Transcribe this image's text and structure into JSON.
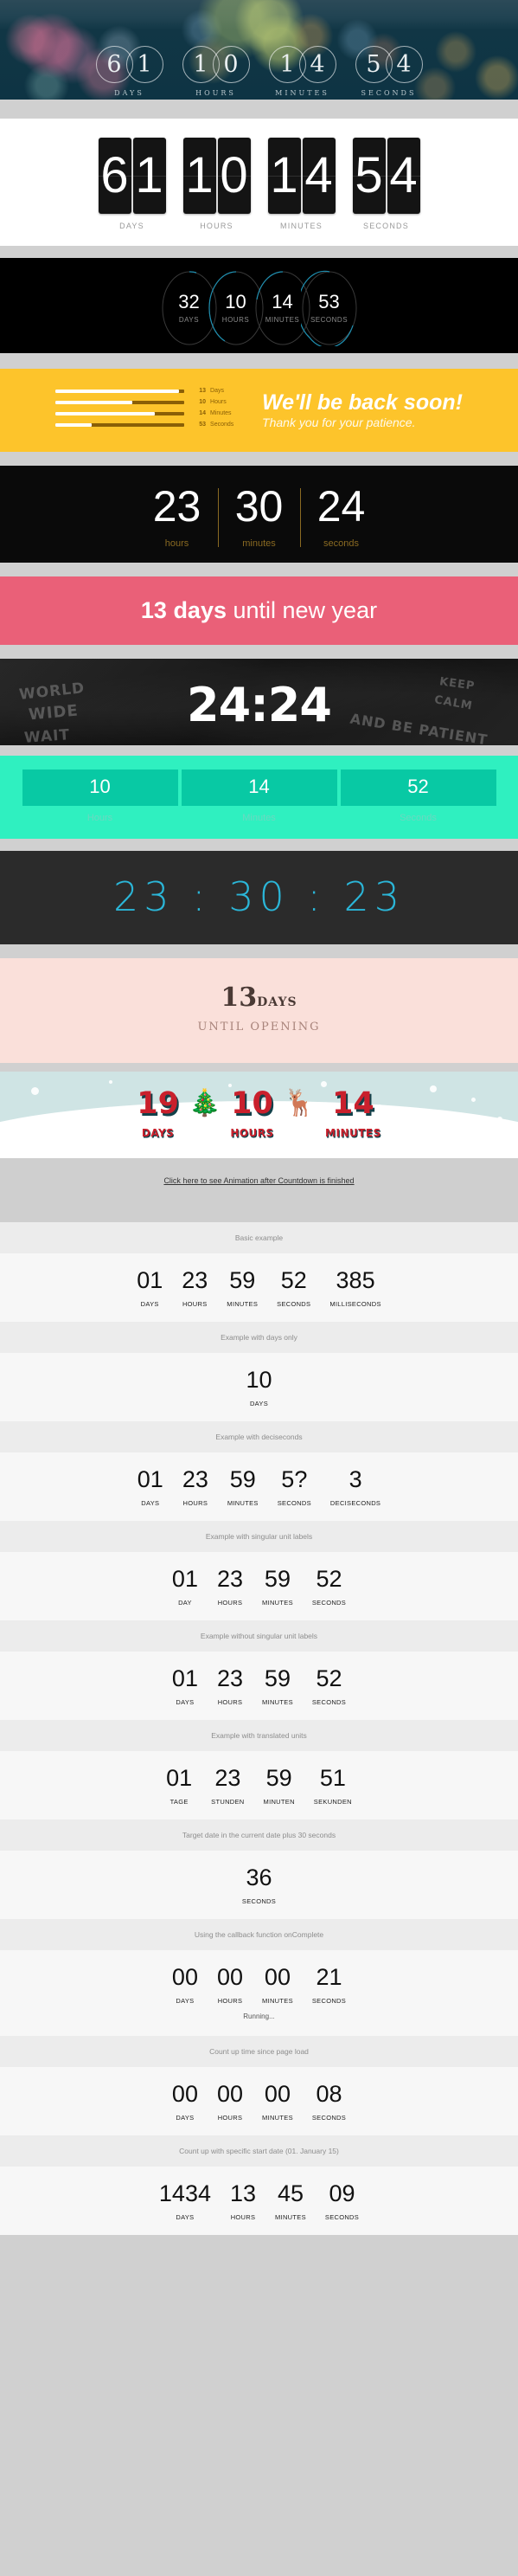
{
  "hero": {
    "digits": [
      "6",
      "1",
      "1",
      "0",
      "1",
      "4",
      "5",
      "4"
    ],
    "labels": [
      "DAYS",
      "HOURS",
      "MINUTES",
      "SECONDS"
    ]
  },
  "flip": {
    "units": [
      {
        "digits": [
          "6",
          "1"
        ],
        "label": "DAYS"
      },
      {
        "digits": [
          "1",
          "0"
        ],
        "label": "HOURS"
      },
      {
        "digits": [
          "1",
          "4"
        ],
        "label": "MINUTES"
      },
      {
        "digits": [
          "5",
          "4"
        ],
        "label": "SECONDS"
      }
    ]
  },
  "rings": {
    "accent": "#1f8fb0",
    "units": [
      {
        "value": "32",
        "label": "DAYS",
        "pct": 10
      },
      {
        "value": "10",
        "label": "HOURS",
        "pct": 42
      },
      {
        "value": "14",
        "label": "MINUTES",
        "pct": 24
      },
      {
        "value": "53",
        "label": "SECONDS",
        "pct": 88
      }
    ]
  },
  "yellow": {
    "bg": "#fdc42b",
    "bars": [
      {
        "value": "13",
        "label": "Days",
        "pct": 96
      },
      {
        "value": "10",
        "label": "Hours",
        "pct": 60
      },
      {
        "value": "14",
        "label": "Minutes",
        "pct": 77
      },
      {
        "value": "53",
        "label": "Seconds",
        "pct": 28
      }
    ],
    "headline": "We'll be back soon!",
    "subline": "Thank you for your patience."
  },
  "thin": {
    "units": [
      {
        "value": "23",
        "label": "hours"
      },
      {
        "value": "30",
        "label": "minutes"
      },
      {
        "value": "24",
        "label": "seconds"
      }
    ]
  },
  "pink": {
    "bg": "#ea6078",
    "strong": "13 days",
    "rest": " until new year"
  },
  "graffiti": {
    "clock": "24:24",
    "chalk": [
      "WORLD",
      "WIDE",
      "WAIT",
      "KEEP",
      "CALM",
      "AND BE PATIENT"
    ]
  },
  "teal": {
    "bg": "#2ff0c0",
    "units": [
      {
        "value": "10",
        "label": "Hours"
      },
      {
        "value": "14",
        "label": "Minutes"
      },
      {
        "value": "52",
        "label": "Seconds"
      }
    ]
  },
  "digital": {
    "accent": "#2bb6d8",
    "time": "23 : 30 : 23"
  },
  "blush": {
    "bg": "#fae0da",
    "number": "13",
    "unit": "DAYS",
    "sub": "UNTIL OPENING"
  },
  "christmas": {
    "units": [
      {
        "value": "19",
        "label": "DAYS"
      },
      {
        "value": "10",
        "label": "HOURS"
      },
      {
        "value": "14",
        "label": "MINUTES"
      }
    ],
    "decorations": [
      "christmas-tree",
      "reindeer"
    ],
    "deco_glyphs": [
      "🎄",
      "🦌"
    ]
  },
  "link_strip": {
    "text": "Click here to see Animation after Countdown is finished"
  },
  "demos": [
    {
      "title": "Basic example",
      "cols": [
        {
          "n": "01",
          "l": "DAYS"
        },
        {
          "n": "23",
          "l": "HOURS"
        },
        {
          "n": "59",
          "l": "MINUTES"
        },
        {
          "n": "52",
          "l": "SECONDS"
        },
        {
          "n": "385",
          "l": "MILLISECONDS"
        }
      ]
    },
    {
      "title": "Example with days only",
      "cols": [
        {
          "n": "10",
          "l": "DAYS"
        }
      ]
    },
    {
      "title": "Example with deciseconds",
      "cols": [
        {
          "n": "01",
          "l": "DAYS"
        },
        {
          "n": "23",
          "l": "HOURS"
        },
        {
          "n": "59",
          "l": "MINUTES"
        },
        {
          "n": "5?",
          "l": "SECONDS"
        },
        {
          "n": "3",
          "l": "DECISECONDS"
        }
      ]
    },
    {
      "title": "Example with singular unit labels",
      "cols": [
        {
          "n": "01",
          "l": "DAY"
        },
        {
          "n": "23",
          "l": "HOURS"
        },
        {
          "n": "59",
          "l": "MINUTES"
        },
        {
          "n": "52",
          "l": "SECONDS"
        }
      ]
    },
    {
      "title": "Example without singular unit labels",
      "cols": [
        {
          "n": "01",
          "l": "DAYS"
        },
        {
          "n": "23",
          "l": "HOURS"
        },
        {
          "n": "59",
          "l": "MINUTES"
        },
        {
          "n": "52",
          "l": "SECONDS"
        }
      ]
    },
    {
      "title": "Example with translated units",
      "cols": [
        {
          "n": "01",
          "l": "TAGE"
        },
        {
          "n": "23",
          "l": "STUNDEN"
        },
        {
          "n": "59",
          "l": "MINUTEN"
        },
        {
          "n": "51",
          "l": "SEKUNDEN"
        }
      ]
    },
    {
      "title": "Target date in the current date plus 30 seconds",
      "cols": [
        {
          "n": "36",
          "l": "SECONDS"
        }
      ]
    },
    {
      "title": "Using the callback function onComplete",
      "cols": [
        {
          "n": "00",
          "l": "DAYS"
        },
        {
          "n": "00",
          "l": "HOURS"
        },
        {
          "n": "00",
          "l": "MINUTES"
        },
        {
          "n": "21",
          "l": "SECONDS"
        }
      ],
      "note": "Running..."
    },
    {
      "title": "Count up time since page load",
      "cols": [
        {
          "n": "00",
          "l": "DAYS"
        },
        {
          "n": "00",
          "l": "HOURS"
        },
        {
          "n": "00",
          "l": "MINUTES"
        },
        {
          "n": "08",
          "l": "SECONDS"
        }
      ]
    },
    {
      "title": "Count up with specific start date (01. January 15)",
      "cols": [
        {
          "n": "1434",
          "l": "DAYS"
        },
        {
          "n": "13",
          "l": "HOURS"
        },
        {
          "n": "45",
          "l": "MINUTES"
        },
        {
          "n": "09",
          "l": "SECONDS"
        }
      ]
    }
  ]
}
